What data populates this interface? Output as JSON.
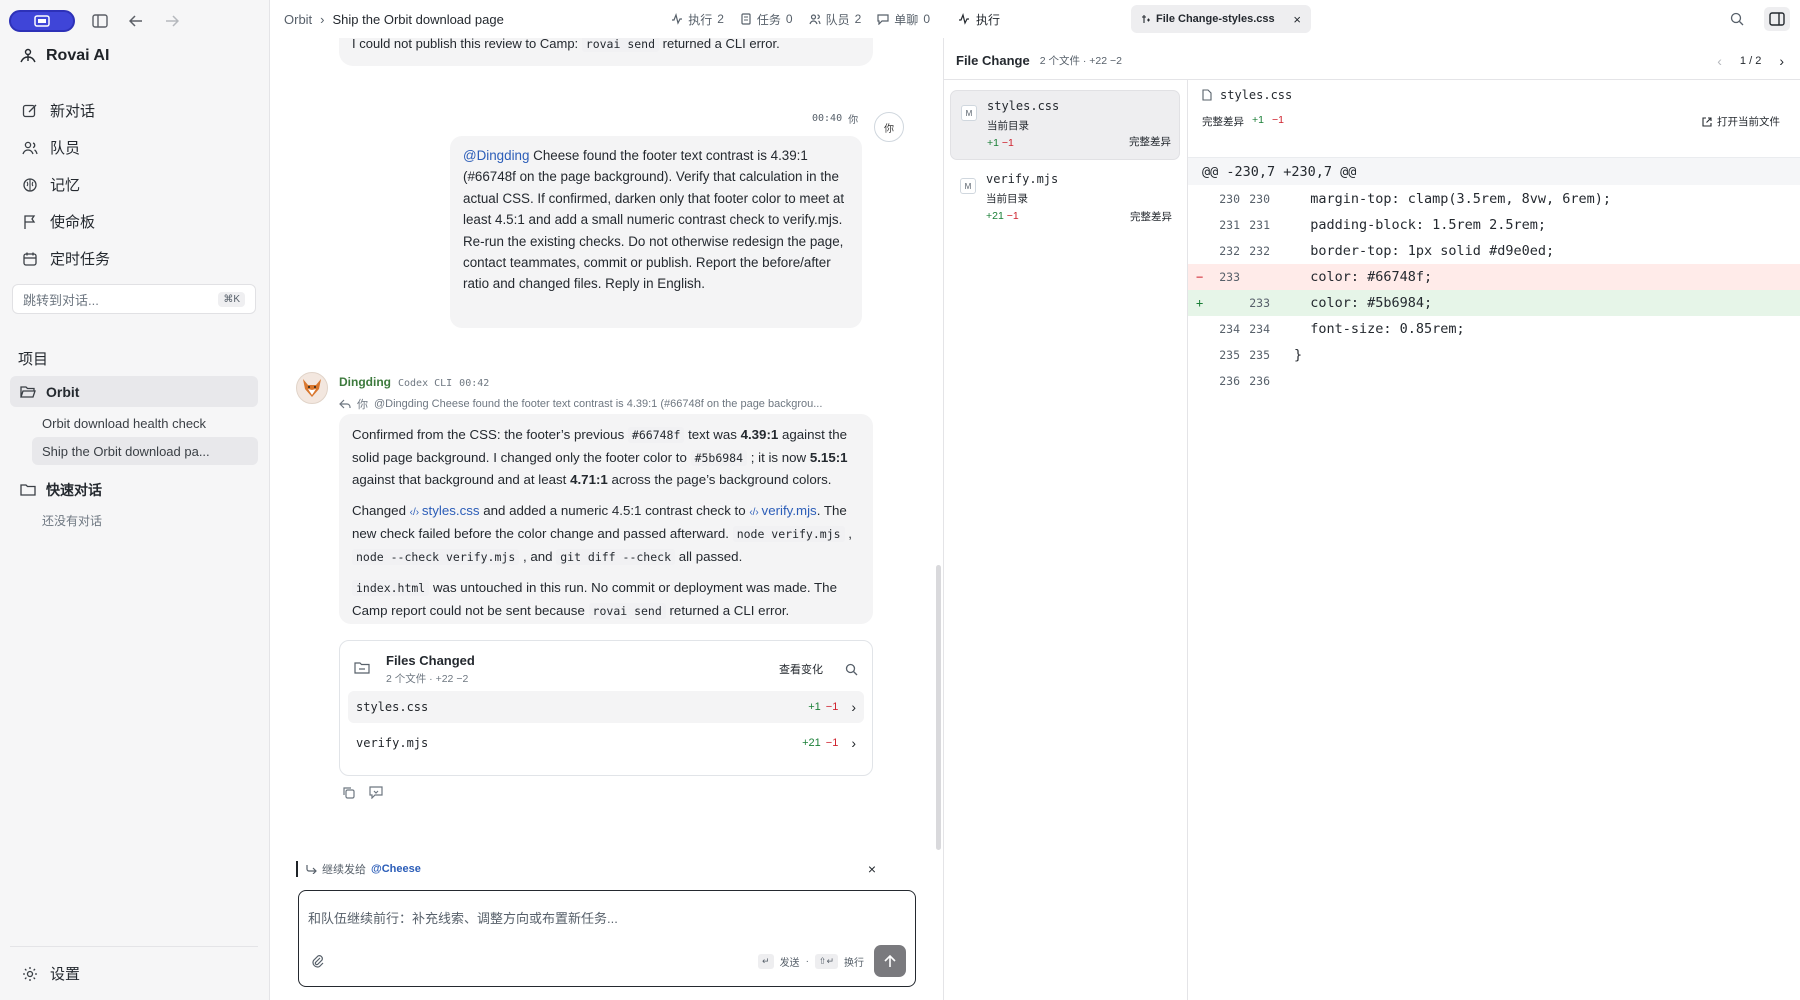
{
  "sidebar": {
    "brand": "Rovai AI",
    "nav": [
      {
        "label": "新对话",
        "icon": "edit-icon"
      },
      {
        "label": "队员",
        "icon": "people-icon"
      },
      {
        "label": "记忆",
        "icon": "brain-icon"
      },
      {
        "label": "使命板",
        "icon": "flag-icon"
      },
      {
        "label": "定时任务",
        "icon": "calendar-icon"
      }
    ],
    "jump_placeholder": "跳转到对话...",
    "jump_shortcut": "⌘K",
    "projects_label": "项目",
    "project": "Orbit",
    "project_items": [
      "Orbit download health check",
      "Ship the Orbit download pa..."
    ],
    "quick_label": "快速对话",
    "quick_empty": "还没有对话",
    "settings": "设置"
  },
  "chat": {
    "breadcrumb_root": "Orbit",
    "breadcrumb_current": "Ship the Orbit download page",
    "stats": [
      {
        "label": "执行",
        "count": "2",
        "icon": "activity-icon"
      },
      {
        "label": "任务",
        "count": "0",
        "icon": "task-icon"
      },
      {
        "label": "队员",
        "count": "2",
        "icon": "people-icon"
      },
      {
        "label": "单聊",
        "count": "0",
        "icon": "chat-icon"
      }
    ],
    "prev_msg_pre": "I could not publish this review to Camp: ",
    "prev_msg_code": "rovai send",
    "prev_msg_post": " returned a CLI error.",
    "user_time": "00:40",
    "user_you": "你",
    "user_avatar": "你",
    "user_mention": "@Dingding",
    "user_text": " Cheese found the footer text contrast is 4.39:1 (#66748f on the page background). Verify that calculation in the actual CSS. If confirmed, darken only that footer color to meet at least 4.5:1 and add a small numeric contrast check to verify.mjs. Re-run the existing checks. Do not otherwise redesign the page, contact teammates, commit or publish. Report the before/after ratio and changed files. Reply in English.",
    "agent_name": "Dingding",
    "agent_tool": "Codex CLI",
    "agent_time": "00:42",
    "reply_quote_you": "你",
    "reply_quote": "@Dingding Cheese found the footer text contrast is 4.39:1 (#66748f on the page backgrou...",
    "p1": {
      "a": "Confirmed from the CSS: the footer’s previous ",
      "c1": "#66748f",
      "b": " text was ",
      "r1": "4.39:1",
      "c": " against the solid page background. I changed only the footer color to ",
      "c2": "#5b6984",
      "d": " ; it is now ",
      "r2": "5.15:1",
      "e": " against that background and at least ",
      "r3": "4.71:1",
      "f": " across the page’s background colors."
    },
    "p2": {
      "a": "Changed ",
      "f1": "styles.css",
      "b": " and added a numeric 4.5:1 contrast check to ",
      "f2": "verify.mjs",
      "c": ". The new check failed before the color change and passed afterward. ",
      "k1": "node verify.mjs",
      "d": " ,",
      "k2": "node --check verify.mjs",
      "e": " , and ",
      "k3": "git diff --check",
      "f": " all passed."
    },
    "p3": {
      "k1": "index.html",
      "a": " was untouched in this run. No commit or deployment was made. The Camp report could not be sent because ",
      "k2": "rovai send",
      "b": " returned a CLI error."
    },
    "files_card": {
      "title": "Files Changed",
      "sub": "2 个文件 · +22 −2",
      "view": "查看变化",
      "rows": [
        {
          "name": "styles.css",
          "add": "+1",
          "del": "−1"
        },
        {
          "name": "verify.mjs",
          "add": "+21",
          "del": "−1"
        }
      ]
    },
    "continue_label": "继续发给",
    "continue_target": "@Cheese",
    "composer_placeholder": "和队伍继续前行：补充线索、调整方向或布置新任务...",
    "hint_send_key": "↵",
    "hint_send": "发送",
    "hint_nl_key": "⇧↵",
    "hint_nl": "换行"
  },
  "panel": {
    "exec_tab": "执行",
    "file_tab": "File Change-styles.css",
    "bar_title": "File Change",
    "bar_sub": "2 个文件 · +22 −2",
    "pager": "1 / 2",
    "files": [
      {
        "badge": "M",
        "name": "styles.css",
        "dir": "当前目录",
        "add": "+1",
        "del": "−1",
        "full": "完整差异"
      },
      {
        "badge": "M",
        "name": "verify.mjs",
        "dir": "当前目录",
        "add": "+21",
        "del": "−1",
        "full": "完整差异"
      }
    ],
    "diff_file": "styles.css",
    "diff_sub": "完整差异",
    "diff_add": "+1",
    "diff_del": "−1",
    "open_file": "打开当前文件",
    "hunk": "@@ -230,7 +230,7 @@",
    "lines": [
      {
        "sign": "",
        "old": "230",
        "new": "230",
        "code": "  margin-top: clamp(3.5rem, 8vw, 6rem);",
        "type": "ctx"
      },
      {
        "sign": "",
        "old": "231",
        "new": "231",
        "code": "  padding-block: 1.5rem 2.5rem;",
        "type": "ctx"
      },
      {
        "sign": "",
        "old": "232",
        "new": "232",
        "code": "  border-top: 1px solid #d9e0ed;",
        "type": "ctx"
      },
      {
        "sign": "−",
        "old": "233",
        "new": "",
        "code": "  color: #66748f;",
        "type": "del"
      },
      {
        "sign": "+",
        "old": "",
        "new": "233",
        "code": "  color: #5b6984;",
        "type": "add"
      },
      {
        "sign": "",
        "old": "234",
        "new": "234",
        "code": "  font-size: 0.85rem;",
        "type": "ctx"
      },
      {
        "sign": "",
        "old": "235",
        "new": "235",
        "code": "}",
        "type": "ctx"
      },
      {
        "sign": "",
        "old": "236",
        "new": "236",
        "code": "",
        "type": "ctx"
      }
    ]
  }
}
